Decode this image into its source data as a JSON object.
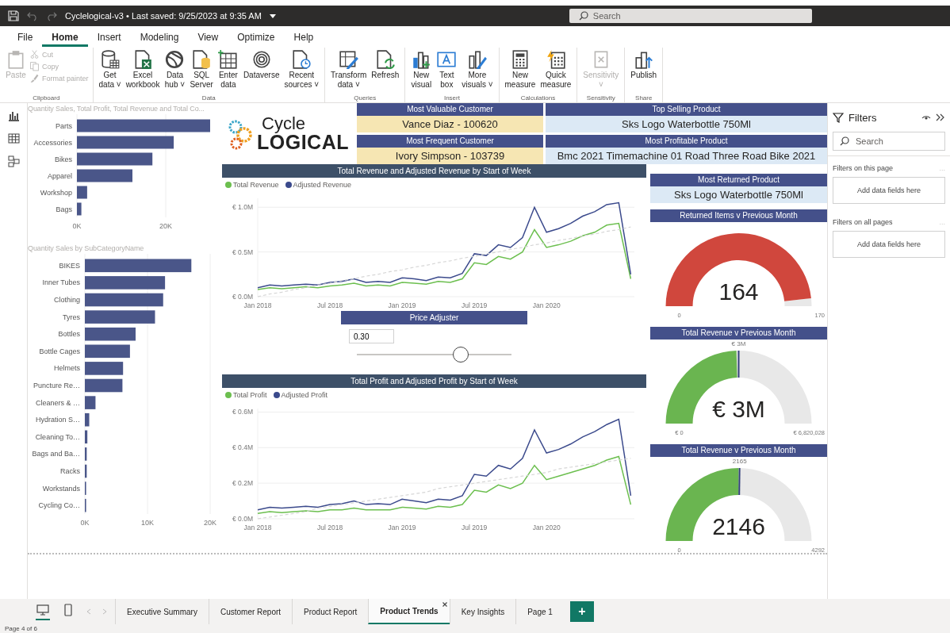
{
  "title_bar": {
    "title": "Cyclelogical-v3 • Last saved: 9/25/2023 at 9:35 AM",
    "search": {
      "placeholder": "Search"
    }
  },
  "menu": [
    {
      "label": "File",
      "selected": false
    },
    {
      "label": "Home",
      "selected": true
    },
    {
      "label": "Insert",
      "selected": false
    },
    {
      "label": "Modeling",
      "selected": false
    },
    {
      "label": "View",
      "selected": false
    },
    {
      "label": "Optimize",
      "selected": false
    },
    {
      "label": "Help",
      "selected": false
    }
  ],
  "ribbon": [
    {
      "group": "Clipboard",
      "items": [
        {
          "kind": "large",
          "lines": [
            "Paste"
          ],
          "disabled": true
        },
        {
          "kind": "small",
          "lines": [
            "Cut"
          ],
          "disabled": true
        },
        {
          "kind": "small",
          "lines": [
            "Copy"
          ],
          "disabled": true
        },
        {
          "kind": "small",
          "lines": [
            "Format painter"
          ],
          "disabled": true
        }
      ]
    },
    {
      "group": "Data",
      "items": [
        {
          "kind": "large",
          "lines": [
            "Get",
            "data ˅"
          ],
          "disabled": false
        },
        {
          "kind": "large",
          "lines": [
            "Excel",
            "workbook"
          ],
          "disabled": false
        },
        {
          "kind": "large",
          "lines": [
            "Data",
            "hub ˅"
          ],
          "disabled": false
        },
        {
          "kind": "large",
          "lines": [
            "SQL",
            "Server"
          ],
          "disabled": false
        },
        {
          "kind": "large",
          "lines": [
            "Enter",
            "data"
          ],
          "disabled": false
        },
        {
          "kind": "large",
          "lines": [
            "Dataverse"
          ],
          "disabled": false
        },
        {
          "kind": "large",
          "lines": [
            "Recent",
            "sources ˅"
          ],
          "disabled": false
        }
      ]
    },
    {
      "group": "Queries",
      "items": [
        {
          "kind": "large",
          "lines": [
            "Transform",
            "data ˅"
          ],
          "disabled": false
        },
        {
          "kind": "large",
          "lines": [
            "Refresh"
          ],
          "disabled": false
        }
      ]
    },
    {
      "group": "Insert",
      "items": [
        {
          "kind": "large",
          "lines": [
            "New",
            "visual"
          ],
          "disabled": false
        },
        {
          "kind": "large",
          "lines": [
            "Text",
            "box"
          ],
          "disabled": false
        },
        {
          "kind": "large",
          "lines": [
            "More",
            "visuals ˅"
          ],
          "disabled": false
        }
      ]
    },
    {
      "group": "Calculations",
      "items": [
        {
          "kind": "large",
          "lines": [
            "New",
            "measure"
          ],
          "disabled": false
        },
        {
          "kind": "large",
          "lines": [
            "Quick",
            "measure"
          ],
          "disabled": false
        }
      ]
    },
    {
      "group": "Sensitivity",
      "items": [
        {
          "kind": "large",
          "lines": [
            "Sensitivity",
            "˅"
          ],
          "disabled": true
        }
      ]
    },
    {
      "group": "Share",
      "items": [
        {
          "kind": "large",
          "lines": [
            "Publish"
          ],
          "disabled": false
        }
      ]
    }
  ],
  "bar_charts": [
    {
      "title": "Quantity Sales, Total Profit, Total Revenue and Total Co...",
      "chart_data": {
        "type": "bar",
        "orientation": "horizontal",
        "categories": [
          "Parts",
          "Accessories",
          "Bikes",
          "Apparel",
          "Workshop",
          "Bags"
        ],
        "values": [
          30,
          21.8,
          17,
          12.5,
          2.3,
          1
        ],
        "xlim": [
          0,
          30
        ],
        "xticks": [
          {
            "value": 0,
            "label": "0K"
          },
          {
            "value": 20,
            "label": "20K"
          }
        ]
      }
    },
    {
      "title": "Quantity Sales by SubCategoryName",
      "chart_data": {
        "type": "bar",
        "orientation": "horizontal",
        "categories": [
          "BIKES",
          "Inner Tubes",
          "Clothing",
          "Tyres",
          "Bottles",
          "Bottle Cages",
          "Helmets",
          "Puncture Re…",
          "Cleaners & …",
          "Hydration S…",
          "Cleaning To…",
          "Bags and Ba…",
          "Racks",
          "Workstands",
          "Cycling Co…"
        ],
        "values": [
          17,
          12.8,
          12.5,
          11.2,
          8.1,
          7.2,
          6.1,
          6,
          1.7,
          0.7,
          0.4,
          0.3,
          0.3,
          0.2,
          0.2
        ],
        "xlim": [
          0,
          20
        ],
        "xticks": [
          {
            "value": 0,
            "label": "0K"
          },
          {
            "value": 10,
            "label": "10K"
          },
          {
            "value": 20,
            "label": "20K"
          }
        ]
      }
    }
  ],
  "logo": {
    "line1": "Cycle",
    "line2": "LOGICAL"
  },
  "cards": [
    {
      "title": "Most Valuable Customer",
      "value": "Vance Diaz - 100620",
      "color": "#f6e6b3"
    },
    {
      "title": "Top Selling Product",
      "value": "Sks Logo Waterbottle 750Ml",
      "color": "#dce9f5"
    },
    {
      "title": "Most Frequent Customer",
      "value": "Ivory Simpson - 103739",
      "color": "#f6e6b3"
    },
    {
      "title": "Most Profitable Product",
      "value": "Bmc 2021 Timemachine 01 Road Three Road Bike 2021",
      "color": "#dce9f5"
    }
  ],
  "line_charts": [
    {
      "title": "Total Revenue and Adjusted Revenue by Start of Week",
      "chart_data": {
        "type": "line",
        "categories": [
          "Jan 2018",
          null,
          null,
          null,
          null,
          null,
          "Jul 2018",
          null,
          null,
          null,
          null,
          null,
          "Jan 2019",
          null,
          null,
          null,
          null,
          null,
          "Jul 2019",
          null,
          null,
          null,
          null,
          null,
          "Jan 2020",
          null,
          null,
          null,
          null,
          null,
          null,
          null
        ],
        "grid": true,
        "ylim": [
          0,
          1.1
        ],
        "yticks": [
          {
            "value": 0,
            "label": "€ 0.0M"
          },
          {
            "value": 0.5,
            "label": "€ 0.5M"
          },
          {
            "value": 1,
            "label": "€ 1.0M"
          }
        ],
        "series": [
          {
            "name": "Total Revenue",
            "color": "#6cbf4f",
            "values": [
              0.08,
              0.1,
              0.09,
              0.1,
              0.11,
              0.1,
              0.12,
              0.13,
              0.15,
              0.12,
              0.13,
              0.12,
              0.16,
              0.15,
              0.14,
              0.17,
              0.16,
              0.2,
              0.38,
              0.36,
              0.45,
              0.42,
              0.5,
              0.75,
              0.55,
              0.58,
              0.62,
              0.68,
              0.72,
              0.8,
              0.82,
              0.2
            ]
          },
          {
            "name": "Adjusted Revenue",
            "color": "#3b4a8c",
            "values": [
              0.1,
              0.13,
              0.12,
              0.13,
              0.14,
              0.13,
              0.16,
              0.17,
              0.2,
              0.16,
              0.17,
              0.16,
              0.21,
              0.2,
              0.18,
              0.22,
              0.21,
              0.26,
              0.48,
              0.46,
              0.58,
              0.55,
              0.66,
              1.0,
              0.72,
              0.76,
              0.82,
              0.9,
              0.95,
              1.03,
              1.05,
              0.25
            ]
          },
          {
            "color": "#d6d6d6",
            "line_style": "dashed",
            "values": [
              0,
              0.03,
              0.05,
              0.08,
              0.1,
              0.13,
              0.15,
              0.18,
              0.2,
              0.23,
              0.25,
              0.28,
              0.3,
              0.33,
              0.35,
              0.38,
              0.4,
              0.43,
              0.45,
              0.48,
              0.5,
              0.53,
              0.55,
              0.58,
              0.6,
              0.63,
              0.65,
              0.68,
              0.7,
              0.73,
              0.75,
              0.78
            ]
          }
        ]
      }
    },
    {
      "title": "Total Profit and Adjusted Profit by Start of Week",
      "chart_data": {
        "type": "line",
        "categories": [
          "Jan 2018",
          null,
          null,
          null,
          null,
          null,
          "Jul 2018",
          null,
          null,
          null,
          null,
          null,
          "Jan 2019",
          null,
          null,
          null,
          null,
          null,
          "Jul 2019",
          null,
          null,
          null,
          null,
          null,
          "Jan 2020",
          null,
          null,
          null,
          null,
          null,
          null,
          null
        ],
        "grid": true,
        "ylim": [
          0,
          0.62
        ],
        "yticks": [
          {
            "value": 0,
            "label": "€ 0.0M"
          },
          {
            "value": 0.2,
            "label": "€ 0.2M"
          },
          {
            "value": 0.4,
            "label": "€ 0.4M"
          },
          {
            "value": 0.6,
            "label": "€ 0.6M"
          }
        ],
        "series": [
          {
            "name": "Total Profit",
            "color": "#6cbf4f",
            "values": [
              0.03,
              0.04,
              0.035,
              0.04,
              0.045,
              0.04,
              0.05,
              0.05,
              0.06,
              0.05,
              0.05,
              0.05,
              0.065,
              0.06,
              0.055,
              0.07,
              0.065,
              0.08,
              0.16,
              0.15,
              0.19,
              0.17,
              0.2,
              0.3,
              0.22,
              0.24,
              0.26,
              0.28,
              0.3,
              0.33,
              0.35,
              0.08
            ]
          },
          {
            "name": "Adjusted Profit",
            "color": "#3b4a8c",
            "values": [
              0.05,
              0.065,
              0.06,
              0.065,
              0.07,
              0.065,
              0.08,
              0.085,
              0.1,
              0.08,
              0.085,
              0.08,
              0.11,
              0.1,
              0.09,
              0.11,
              0.105,
              0.13,
              0.25,
              0.24,
              0.3,
              0.28,
              0.34,
              0.5,
              0.37,
              0.39,
              0.42,
              0.46,
              0.49,
              0.53,
              0.56,
              0.13
            ]
          },
          {
            "color": "#d6d6d6",
            "line_style": "dashed",
            "values": [
              0,
              0.01,
              0.02,
              0.03,
              0.04,
              0.06,
              0.07,
              0.08,
              0.09,
              0.1,
              0.11,
              0.12,
              0.13,
              0.14,
              0.15,
              0.17,
              0.18,
              0.19,
              0.2,
              0.21,
              0.22,
              0.23,
              0.24,
              0.25,
              0.26,
              0.28,
              0.29,
              0.3,
              0.31,
              0.32,
              0.33,
              0.34
            ]
          }
        ]
      }
    }
  ],
  "price_adjuster": {
    "title": "Price Adjuster",
    "value": "0.30",
    "level": 0.67
  },
  "returned_card": {
    "title": "Most Returned Product",
    "value": "Sks Logo Waterbottle 750Ml",
    "color": "#dce9f5"
  },
  "gauges": [
    {
      "title": "Returned Items v Previous Month",
      "value": "164",
      "min": "0",
      "max": "170",
      "color": "#d0473d"
    },
    {
      "title": "Total Revenue v Previous Month",
      "value": "€ 3M",
      "min": "€ 0",
      "max": "€ 6,820,028",
      "color": "#6ab550",
      "target": "€ 3M"
    },
    {
      "title": "Total Revenue v Previous Month",
      "value": "2146",
      "min": "0",
      "max": "4292",
      "color": "#6ab550",
      "target": "2165"
    }
  ],
  "filters": {
    "title": "Filters",
    "search": {
      "placeholder": "Search"
    },
    "sections": [
      {
        "title": "Filters on this page",
        "more": "...",
        "drop_zone": "Add data fields here"
      },
      {
        "title": "Filters on all pages",
        "more": "...",
        "drop_zone": "Add data fields here"
      }
    ]
  },
  "views": [
    {
      "selected": true
    },
    {
      "selected": false
    }
  ],
  "page_tabs": [
    {
      "label": "Executive Summary",
      "selected": false
    },
    {
      "label": "Customer Report",
      "selected": false
    },
    {
      "label": "Product Report",
      "selected": false
    },
    {
      "label": "Product Trends",
      "selected": true
    },
    {
      "label": "Key Insights",
      "selected": false
    },
    {
      "label": "Page 1",
      "selected": false
    }
  ],
  "add_page": "+",
  "status": "Page 4 of 6"
}
